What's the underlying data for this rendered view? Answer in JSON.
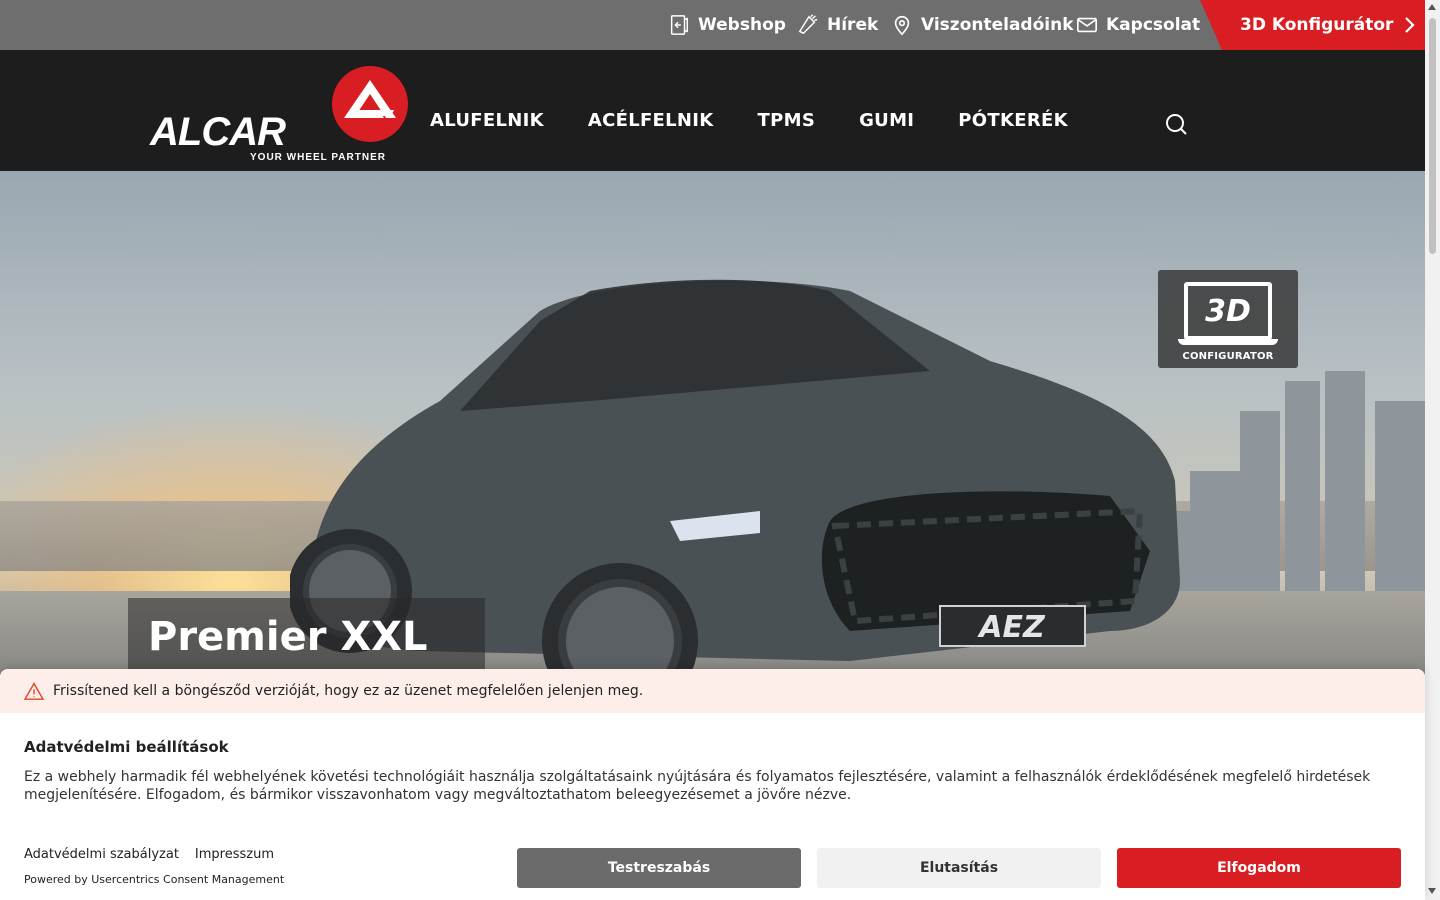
{
  "topbar": {
    "links": [
      {
        "label": "Webshop",
        "icon": "webshop-icon"
      },
      {
        "label": "Hírek",
        "icon": "megaphone-icon"
      },
      {
        "label": "Viszonteladóink",
        "icon": "location-pin-icon"
      },
      {
        "label": "Kapcsolat",
        "icon": "mail-icon"
      }
    ],
    "cta_label": "3D Konfigurátor",
    "cta_color": "#d81e22",
    "bg_color": "#6e6e6e"
  },
  "logo": {
    "wordmark": "ALCAR",
    "tagline": "YOUR WHEEL PARTNER"
  },
  "nav": {
    "items": [
      "ALUFELNIK",
      "ACÉLFELNIK",
      "TPMS",
      "GUMI",
      "PÓTKERÉK"
    ],
    "bg_color": "#1d1d1d"
  },
  "hero": {
    "title": "Premier XXL",
    "badge_screen": "3D",
    "badge_caption": "CONFIGURATOR",
    "plate_text": "AEZ"
  },
  "consent": {
    "warning": "Frissítened kell a böngésződ verzióját, hogy ez az üzenet megfelelően jelenjen meg.",
    "title": "Adatvédelmi beállítások",
    "text": "Ez a webhely harmadik fél webhelyének követési technológiáit használja szolgáltatásaink nyújtására és folyamatos fejlesztésére, valamint a felhasználók érdeklődésének megfelelő hirdetések megjelenítésére. Elfogadom, és bármikor visszavonhatom vagy megváltoztathatom beleegyezésemet a jövőre nézve.",
    "links": [
      "Adatvédelmi szabályzat",
      "Impresszum"
    ],
    "powered": "Powered by Usercentrics Consent Management",
    "buttons": {
      "customize": "Testreszabás",
      "deny": "Elutasítás",
      "accept": "Elfogadom"
    }
  }
}
